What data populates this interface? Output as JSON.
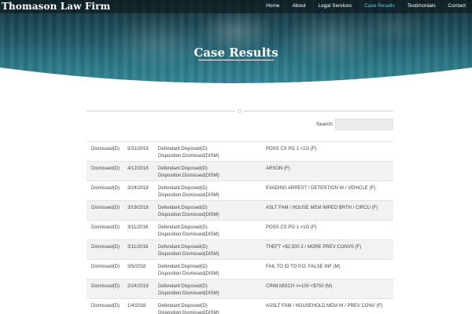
{
  "header": {
    "brand": "Thomason Law Firm",
    "nav": [
      {
        "label": "Home",
        "active": false
      },
      {
        "label": "About",
        "active": false
      },
      {
        "label": "Legal Services",
        "active": false
      },
      {
        "label": "Case Results",
        "active": true
      },
      {
        "label": "Testimonials",
        "active": false
      },
      {
        "label": "Contact",
        "active": false
      }
    ],
    "active_color": "#5bd0e2"
  },
  "hero": {
    "title": "Case Results"
  },
  "search": {
    "label": "Search:",
    "value": ""
  },
  "table": {
    "rows": [
      {
        "result": "Dismissed(D)",
        "date": "5/31/2018",
        "line1": "Defendant:Disposed(D)",
        "line2": "Disposition:Dismissed(DISM)",
        "offense": "POSS CS PG 1 <1G (F)"
      },
      {
        "result": "Dismissed(D)",
        "date": "4/12/2018",
        "line1": "Defendant:Disposed(D)",
        "line2": "Disposition:Dismissed(DISM)",
        "offense": "ARSON (F)"
      },
      {
        "result": "Dismissed(D)",
        "date": "3/24/2018",
        "line1": "Defendant:Disposed(D)",
        "line2": "Disposition:Dismissed(DISM)",
        "offense": "EVADING ARREST / DETENTION W / VEHICLE (F)"
      },
      {
        "result": "Dismissed(D)",
        "date": "3/19/2018",
        "line1": "Defendant:Disposed(D)",
        "line2": "Disposition:Dismissed(DISM)",
        "offense": "ASLT FAM / HOUSE MEM IMPED BRTH / CIRCU (F)"
      },
      {
        "result": "Dismissed(D)",
        "date": "3/11/2018",
        "line1": "Defendant:Disposed(D)",
        "line2": "Disposition:Dismissed(DISM)",
        "offense": "POSS CS PG 1 <1G (F)"
      },
      {
        "result": "Dismissed(D)",
        "date": "3/11/2018",
        "line1": "Defendant:Disposed(D)",
        "line2": "Disposition:Dismissed(DISM)",
        "offense": "THEFT <$2,500 2 / MORE PREV CONVS (F)"
      },
      {
        "result": "Dismissed(D)",
        "date": "3/5/2018",
        "line1": "Defendant:Disposed(D)",
        "line2": "Disposition:Dismissed(DISM)",
        "offense": "FAIL TO ID TO P.O. FALSE INF (M)"
      },
      {
        "result": "Dismissed(D)",
        "date": "2/24/2018",
        "line1": "Defendant:Disposed(D)",
        "line2": "Disposition:Dismissed(DISM)",
        "offense": "CRIM MISCH >=100 <$750 (M)"
      },
      {
        "result": "Dismissed(D)",
        "date": "1/4/2018",
        "line1": "Defendant:Disposed(D)",
        "line2": "Disposition:Dismissed(DISM)",
        "offense": "ASSLT FAM / HOUSEHOLD MEM W / PREV CONV (F)"
      }
    ]
  }
}
